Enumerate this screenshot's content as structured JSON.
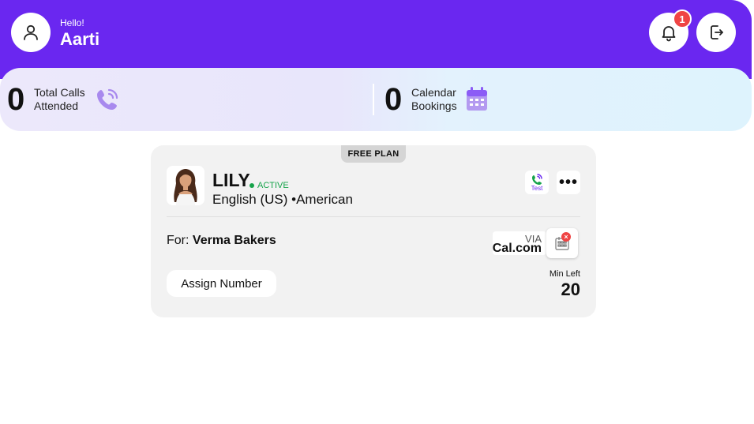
{
  "header": {
    "greeting": "Hello!",
    "user_name": "Aarti",
    "notification_count": "1",
    "icons": [
      "user-icon",
      "bell-icon",
      "logout-icon"
    ],
    "colors": {
      "brand": "#6a27f0",
      "badge": "#ef4444"
    }
  },
  "stats": {
    "calls": {
      "value": "0",
      "label_line1": "Total Calls",
      "label_line2": "Attended",
      "icon": "phone-call-icon"
    },
    "bookings": {
      "value": "0",
      "label_line1": "Calendar",
      "label_line2": "Bookings",
      "icon": "calendar-icon"
    }
  },
  "agent_card": {
    "plan": "FREE PLAN",
    "name": "LILY",
    "status": "ACTIVE",
    "language": "English (US) •American",
    "test_label": "Test",
    "more_label": "•••",
    "for_prefix": "For:",
    "business": "Verma Bakers",
    "via_label": "VIA",
    "integration": "Cal.com",
    "integration_remove": "×",
    "assign_button": "Assign Number",
    "min_left_label": "Min Left",
    "min_left_value": "20",
    "colors": {
      "active": "#16a34a"
    }
  }
}
